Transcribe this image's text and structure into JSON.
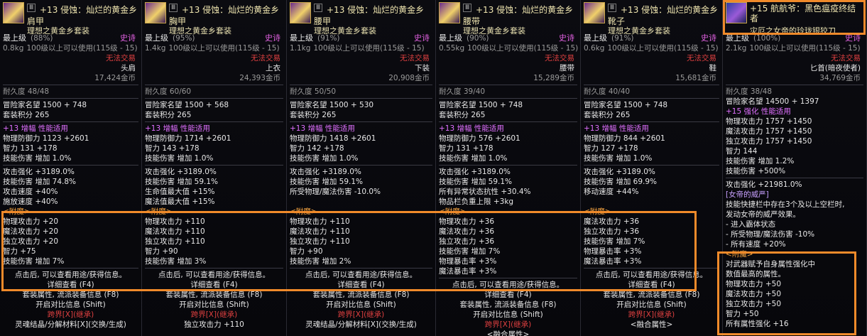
{
  "colors": {
    "accent": "#f08a2a",
    "epic": "#e060e0",
    "gold": "#f0e6b0"
  },
  "panels": [
    {
      "badge": "Ⅲ",
      "name1": "+13 侵蚀：灿烂的黄金乡",
      "name2": "肩甲",
      "set": "理想之黄金乡套装",
      "level": "最上级",
      "pct": "(88%)",
      "rarity": "史诗",
      "weight": "0.8kg",
      "req": "100级以上可以使用(115级 - 15)",
      "trade": "无法交易",
      "slot": "头肩",
      "price": "17,424金币",
      "dur": "耐久度 48/48",
      "fame": "冒险家名望 1500 + 748",
      "setpts": "套装积分 265",
      "amp": "+13 增幅 性能适用",
      "stats": [
        "物理防御力 1123 +2601",
        "智力 131 +178",
        "技能伤害 增加 1.0%"
      ],
      "bonus": [
        "攻击强化 +3189.0%",
        "技能伤害 增加 74.8%",
        "攻击速度 +40%",
        "施放速度 +40%"
      ],
      "ench_title": "<附魔>",
      "ench": [
        "物理攻击力 +20",
        "魔法攻击力 +20",
        "独立攻击力 +20",
        "智力 +75",
        "技能伤害 增加 7%"
      ],
      "foot": [
        "点击后, 可以查看用途/获得信息。",
        "详细查看 (F4)",
        "套装属性, 流派装备信息 (F8)",
        "开启对比信息 (Shift)",
        "跨界[X](继承)",
        "灵魂结晶/分解材料[X](交换/生成)"
      ]
    },
    {
      "badge": "Ⅲ",
      "name1": "+13 侵蚀：灿烂的黄金乡",
      "name2": "胸甲",
      "set": "理想之黄金乡套装",
      "level": "最上级",
      "pct": "(95%)",
      "rarity": "史诗",
      "weight": "1.4kg",
      "req": "100级以上可以使用(115级 - 15)",
      "trade": "无法交易",
      "slot": "上衣",
      "price": "24,393金币",
      "dur": "耐久度 60/60",
      "fame": "冒险家名望 1500 + 568",
      "setpts": "套装积分 265",
      "amp": "+13 增幅 性能适用",
      "stats": [
        "物理防御力 1714 +2601",
        "智力 143 +178",
        "技能伤害 增加 1.0%"
      ],
      "bonus": [
        "攻击强化 +3189.0%",
        "技能伤害 增加 59.1%",
        "生命值最大值 +15%",
        "魔法值最大值 +15%"
      ],
      "ench_title": "<附魔>",
      "ench": [
        "物理攻击力 +110",
        "魔法攻击力 +110",
        "独立攻击力 +110",
        "智力 +90",
        "技能伤害 增加 3%"
      ],
      "foot": [
        "点击后, 可以查看用途/获得信息。",
        "详细查看 (F4)",
        "套装属性, 流派装备信息 (F8)",
        "开启对比信息 (Shift)",
        "跨界[X](继承)",
        "独立攻击力 +110"
      ]
    },
    {
      "badge": "Ⅲ",
      "name1": "+13 侵蚀：灿烂的黄金乡",
      "name2": "腰甲",
      "set": "理想之黄金乡套装",
      "level": "最上级",
      "pct": "(91%)",
      "rarity": "史诗",
      "weight": "1.1kg",
      "req": "100级以上可以使用(115级 - 15)",
      "trade": "无法交易",
      "slot": "下装",
      "price": "20,908金币",
      "dur": "耐久度 50/50",
      "fame": "冒险家名望 1500 + 530",
      "setpts": "套装积分 265",
      "amp": "+13 增幅 性能适用",
      "stats": [
        "物理防御力 1418 +2601",
        "智力 142 +178",
        "技能伤害 增加 1.0%"
      ],
      "bonus": [
        "攻击强化 +3189.0%",
        "技能伤害 增加 59.1%",
        "所受物理/魔法伤害 -10.0%",
        ""
      ],
      "ench_title": "<附魔>",
      "ench": [
        "物理攻击力 +110",
        "魔法攻击力 +110",
        "独立攻击力 +110",
        "智力 +90",
        "技能伤害 增加 2%"
      ],
      "foot": [
        "点击后, 可以查看用途/获得信息。",
        "详细查看 (F4)",
        "套装属性, 流派装备信息 (F8)",
        "开启对比信息 (Shift)",
        "跨界[X](继承)",
        "灵魂结晶/分解材料[X](交换/生成)"
      ]
    },
    {
      "badge": "Ⅲ",
      "name1": "+13 侵蚀：灿烂的黄金乡",
      "name2": "腰带",
      "set": "理想之黄金乡套装",
      "level": "最上级",
      "pct": "(90%)",
      "rarity": "史诗",
      "weight": "0.55kg",
      "req": "100级以上可以使用(115级 - 15)",
      "trade": "无法交易",
      "slot": "腰带",
      "price": "15,289金币",
      "dur": "耐久度 39/40",
      "fame": "冒险家名望 1500 + 748",
      "setpts": "套装积分 265",
      "amp": "+13 增幅 性能适用",
      "stats": [
        "物理防御力 576 +2601",
        "智力 131 +178",
        "技能伤害 增加 1.0%"
      ],
      "bonus": [
        "攻击强化 +3189.0%",
        "技能伤害 增加 59.1%",
        "所有异常状态抗性 +30.4%",
        "物品栏负重上限 +3kg"
      ],
      "ench_title": "<附魔>",
      "ench": [
        "物理攻击力 +36",
        "魔法攻击力 +36",
        "独立攻击力 +36",
        "技能伤害 增加 7%",
        "物理暴击率 +3%",
        "魔法暴击率 +3%"
      ],
      "foot": [
        "点击后, 可以查看用途/获得信息。",
        "详细查看 (F4)",
        "套装属性, 流派装备信息 (F8)",
        "开启对比信息 (Shift)",
        "跨界[X](继承)",
        "<融合属性>"
      ]
    },
    {
      "badge": "Ⅲ",
      "name1": "+13 侵蚀：灿烂的黄金乡",
      "name2": "靴子",
      "set": "理想之黄金乡套装",
      "level": "最上级",
      "pct": "(91%)",
      "rarity": "史诗",
      "weight": "0.6kg",
      "req": "100级以上可以使用(115级 - 15)",
      "trade": "无法交易",
      "slot": "鞋",
      "price": "15,681金币",
      "dur": "耐久度 40/40",
      "fame": "冒险家名望 1500 + 748",
      "setpts": "套装积分 265",
      "amp": "+13 增幅 性能适用",
      "stats": [
        "物理防御力 844 +2601",
        "智力 127 +178",
        "技能伤害 增加 1.0%"
      ],
      "bonus": [
        "攻击强化 +3189.0%",
        "技能伤害 增加 69.9%",
        "移动速度 +44%",
        ""
      ],
      "ench_title": "<附魔>",
      "ench": [
        "魔法攻击力 +36",
        "独立攻击力 +36",
        "技能伤害 增加 7%",
        "物理暴击率 +3%",
        "魔法暴击率 +3%"
      ],
      "foot": [
        "点击后, 可以查看用途/获得信息。",
        "详细查看 (F4)",
        "套装属性, 流派装备信息 (F8)",
        "开启对比信息 (Shift)",
        "跨界[X](继承)",
        "<融合属性>"
      ]
    }
  ],
  "weapon": {
    "name1": "+15 航航爷：黑色瘟疫终结者",
    "set": "灾厄之女帝的玲珑银狡刀",
    "level": "最上级",
    "pct": "(100%)",
    "rarity": "史诗",
    "weight": "2.1kg",
    "req": "100级以上可以使用(115级 - 15)",
    "trade": "无法交易",
    "slot": "匕首(暗夜使者)",
    "price": "34,769金币",
    "dur": "耐久度 38/48",
    "fame": "冒险家名望 14500 + 1397",
    "amp": "+15 强化 性能适用",
    "stats": [
      "物理攻击力 1757 +1450",
      "魔法攻击力 1757 +1450",
      "独立攻击力 1757 +1450",
      "智力 144",
      "技能伤害 增加 1.2%",
      "技能伤害 +500%"
    ],
    "bonus": [
      "攻击强化 +21981.0%",
      "[女帝的威严]",
      "技能快捷栏中存在3个及以上空栏时,",
      "发动女帝的威严效果。",
      "- 进入霸体状态",
      "- 所受物理/魔法伤害 -10%",
      "- 所有速度 +20%"
    ],
    "ench_title": "<附魔>",
    "ench_desc": [
      "对武器赋予自身属性强化中",
      "数值最高的属性。"
    ],
    "ench": [
      "物理攻击力 +50",
      "魔法攻击力 +50",
      "独立攻击力 +50",
      "智力 +50",
      "所有属性强化 +16"
    ]
  }
}
